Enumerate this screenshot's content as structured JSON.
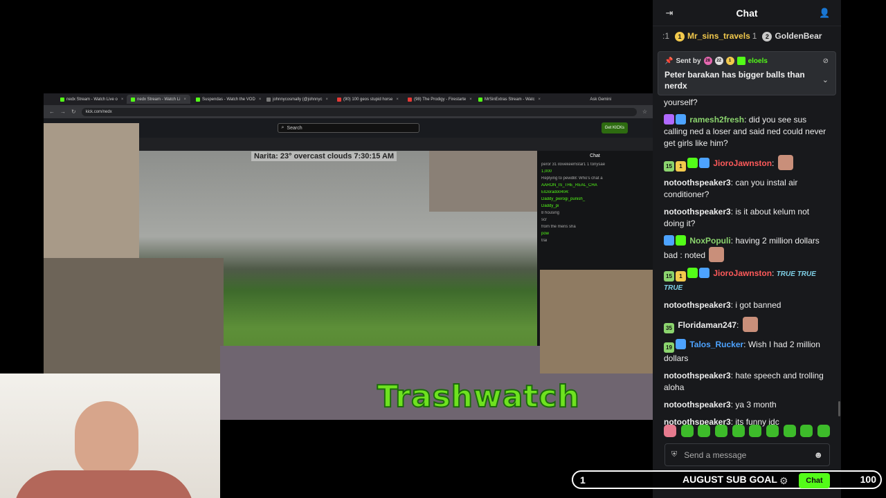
{
  "browser": {
    "tabs": [
      {
        "label": "nedx Stream - Watch Live o",
        "fav": "kick"
      },
      {
        "label": "nedx Stream - Watch Li",
        "fav": "kick",
        "active": true
      },
      {
        "label": "Suspendas - Watch the VOD",
        "fav": "kick"
      },
      {
        "label": "johnnycosmally (@johnnyc",
        "fav": "x"
      },
      {
        "label": "(90) 100 geos stupid horse",
        "fav": "yt"
      },
      {
        "label": "(98) The Prodigy - Firestarte",
        "fav": "yt"
      },
      {
        "label": "MrSinExtras Stream - Watc",
        "fav": "kick"
      }
    ],
    "address": "kick.com/nedx",
    "gemini": "Ask Gemini",
    "search_placeholder": "Search",
    "get_kicks": "Get KICKs",
    "weather": "Narita: 23°     overcast clouds 7:30:15 AM",
    "mini_chat": {
      "title": "Chat",
      "lines": [
        "peror 31  ilovekeemstar1 1  tonysae",
        "1,000",
        "Replying to pewdl8: Who's chat a",
        "AARON_IS_THE_REAL_CHA",
        "ElDorado0404:",
        "Daddy_pierogi_punish_",
        "Daddy_pi",
        "8 housing",
        "scr",
        "from the mens sha",
        "pow",
        "trai"
      ]
    }
  },
  "overlay": {
    "banner": "Trashwatch"
  },
  "chat": {
    "title": "Chat",
    "leaderboard": [
      {
        "rank_text": ":1",
        "badge": "",
        "name": "",
        "count": ""
      },
      {
        "badge": "1",
        "name": "Mr_sins_travels",
        "count": "1",
        "tier": "gold"
      },
      {
        "badge": "2",
        "name": "GoldenBear",
        "count": "",
        "tier": "silver"
      }
    ],
    "pinned": {
      "sent_by_label": "Sent by",
      "badge_a": "28",
      "badge_b": "22",
      "badge_c": "1",
      "sender": "eloels",
      "message": "Peter barakan has bigger balls than nerdx"
    },
    "messages": [
      {
        "user": "",
        "text": "yourself?"
      },
      {
        "user": "ramesh2fresh",
        "color": "#8bd46e",
        "text": "did you see sus calling ned a loser and said ned could never get girls like him?",
        "badges": [
          "purple",
          "blue"
        ]
      },
      {
        "user": "JioroJawnston",
        "color": "#ff5a5a",
        "text": "",
        "badges": [
          "15",
          "1",
          "lime",
          "blue"
        ],
        "emote": true
      },
      {
        "user": "notoothspeaker3",
        "color": "#ededed",
        "text": "can you instal air conditioner?"
      },
      {
        "user": "notoothspeaker3",
        "color": "#ededed",
        "text": "is it about kelum not doing it?"
      },
      {
        "user": "NoxPopuli",
        "color": "#8bd46e",
        "text": "having 2 million dollars bad : noted",
        "badges": [
          "blue",
          "green"
        ],
        "emote": true
      },
      {
        "user": "JioroJawnston",
        "color": "#ff5a5a",
        "text": "TRUE TRUE TRUE",
        "badges": [
          "15",
          "1",
          "lime",
          "blue"
        ]
      },
      {
        "user": "notoothspeaker3",
        "color": "#ededed",
        "text": "i got banned"
      },
      {
        "user": "Floridaman247",
        "color": "#ededed",
        "text": "",
        "badges": [
          "35"
        ],
        "emote": true
      },
      {
        "user": "Talos_Rucker",
        "color": "#4da3ff",
        "text": "Wish I had 2 million dollars",
        "badges": [
          "19",
          "blue"
        ]
      },
      {
        "user": "notoothspeaker3",
        "color": "#ededed",
        "text": "hate speech and trolling aloha"
      },
      {
        "user": "notoothspeaker3",
        "color": "#ededed",
        "text": "ya 3 month"
      },
      {
        "user": "notoothspeaker3",
        "color": "#ededed",
        "text": "its funny idc"
      }
    ],
    "input_placeholder": "Send a message",
    "chat_button": "Chat"
  },
  "goal": {
    "current": "1",
    "title": "AUGUST SUB GOAL",
    "target": "100",
    "progress_fraction": 0.01
  },
  "colors": {
    "kick_green": "#53fc18",
    "chat_bg": "#18191c",
    "pinned_bg": "#2b2d31"
  }
}
